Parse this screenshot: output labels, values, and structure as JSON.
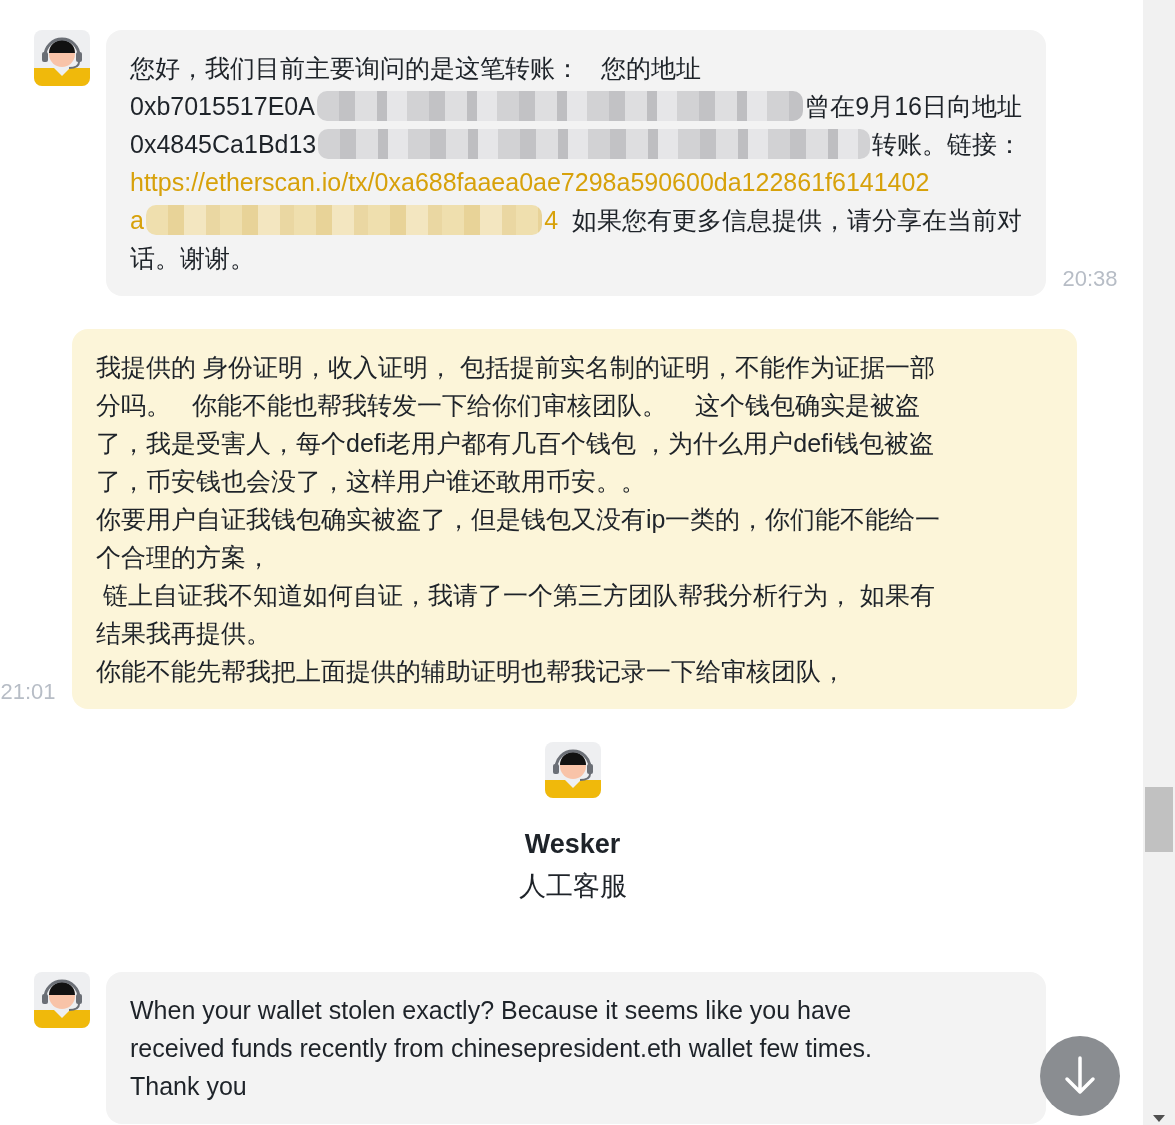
{
  "feed": [
    {
      "kind": "agent_message",
      "time": "20:38",
      "lines": [
        [
          {
            "kind": "text",
            "text": "您好，我们目前主要询问的是这笔转账：   您的地址"
          }
        ],
        [
          {
            "kind": "text",
            "text": "0xb7015517E0A"
          },
          {
            "kind": "redacted"
          },
          {
            "kind": "text",
            "text": "曾在9月16日向地址"
          }
        ],
        [
          {
            "kind": "text",
            "text": "0x4845Ca1Bd13"
          },
          {
            "kind": "redacted"
          },
          {
            "kind": "text",
            "text": "转账。链接："
          }
        ],
        [
          {
            "kind": "link",
            "text": "https://etherscan.io/tx/0xa688faaea0ae7298a590600da122861f6141402"
          }
        ],
        [
          {
            "kind": "link",
            "text": "a"
          },
          {
            "kind": "redacted"
          },
          {
            "kind": "link",
            "text": "4"
          },
          {
            "kind": "text",
            "text": "  如果您有更多信息提供，请分享在当前对"
          }
        ],
        [
          {
            "kind": "text",
            "text": "话。谢谢。"
          }
        ]
      ]
    },
    {
      "kind": "user_message",
      "time": "21:01",
      "lines": [
        [
          {
            "kind": "text",
            "text": "我提供的 身份证明，收入证明， 包括提前实名制的证明，不能作为证据一部"
          }
        ],
        [
          {
            "kind": "text",
            "text": "分吗。   你能不能也帮我转发一下给你们审核团队。    这个钱包确实是被盗"
          }
        ],
        [
          {
            "kind": "text",
            "text": "了，我是受害人，每个defi老用户都有几百个钱包 ，为什么用户defi钱包被盗"
          }
        ],
        [
          {
            "kind": "text",
            "text": "了，币安钱也会没了，这样用户谁还敢用币安。。"
          }
        ],
        [
          {
            "kind": "text",
            "text": "你要用户自证我钱包确实被盗了，但是钱包又没有ip一类的，你们能不能给一"
          }
        ],
        [
          {
            "kind": "text",
            "text": "个合理的方案，"
          }
        ],
        [
          {
            "kind": "text",
            "text": " 链上自证我不知道如何自证，我请了一个第三方团队帮我分析行为， 如果有"
          }
        ],
        [
          {
            "kind": "text",
            "text": "结果我再提供。"
          }
        ],
        [
          {
            "kind": "text",
            "text": "你能不能先帮我把上面提供的辅助证明也帮我记录一下给审核团队，"
          }
        ]
      ]
    },
    {
      "kind": "agent_card",
      "name": "Wesker",
      "role": "人工客服"
    },
    {
      "kind": "agent_message",
      "lines": [
        [
          {
            "kind": "text",
            "text": "When your wallet stolen exactly? Because it seems like you have"
          }
        ],
        [
          {
            "kind": "text",
            "text": "received funds recently from chinesepresident.eth wallet few times."
          }
        ],
        [
          {
            "kind": "text",
            "text": "Thank you"
          }
        ]
      ]
    }
  ]
}
